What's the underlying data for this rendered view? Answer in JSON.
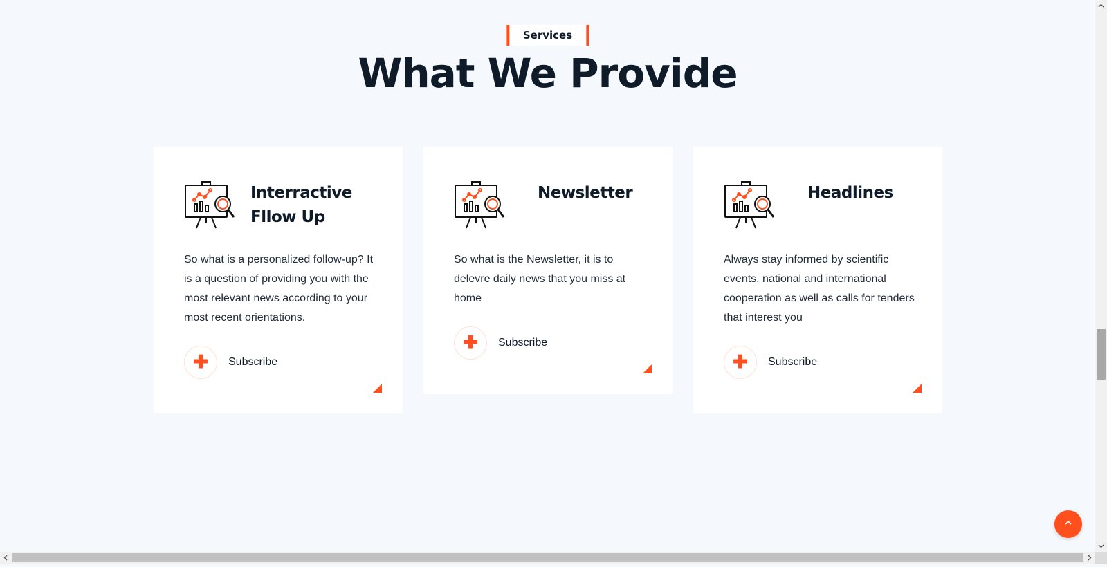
{
  "section": {
    "tag": "Services",
    "title": "What We Provide"
  },
  "cards": [
    {
      "title": "Interractive Fllow Up",
      "text": "So what is a personalized follow-up? It is a question of providing you with the most relevant news according to your most recent orientations.",
      "action_label": "Subscribe",
      "icon": "presentation-analytics-icon"
    },
    {
      "title": "Newsletter",
      "text": "So what is the Newsletter, it is to delevre daily news that you miss at home",
      "action_label": "Subscribe",
      "icon": "presentation-analytics-icon"
    },
    {
      "title": "Headlines",
      "text": "Always stay informed by scientific events, national and international cooperation as well as calls for tenders that interest you",
      "action_label": "Subscribe",
      "icon": "presentation-analytics-icon"
    }
  ],
  "scroll_top": {
    "icon": "chevron-up-icon"
  },
  "colors": {
    "accent": "#ff4f1f",
    "heading": "#101b29",
    "background": "#f5f9fd",
    "card": "#ffffff"
  }
}
